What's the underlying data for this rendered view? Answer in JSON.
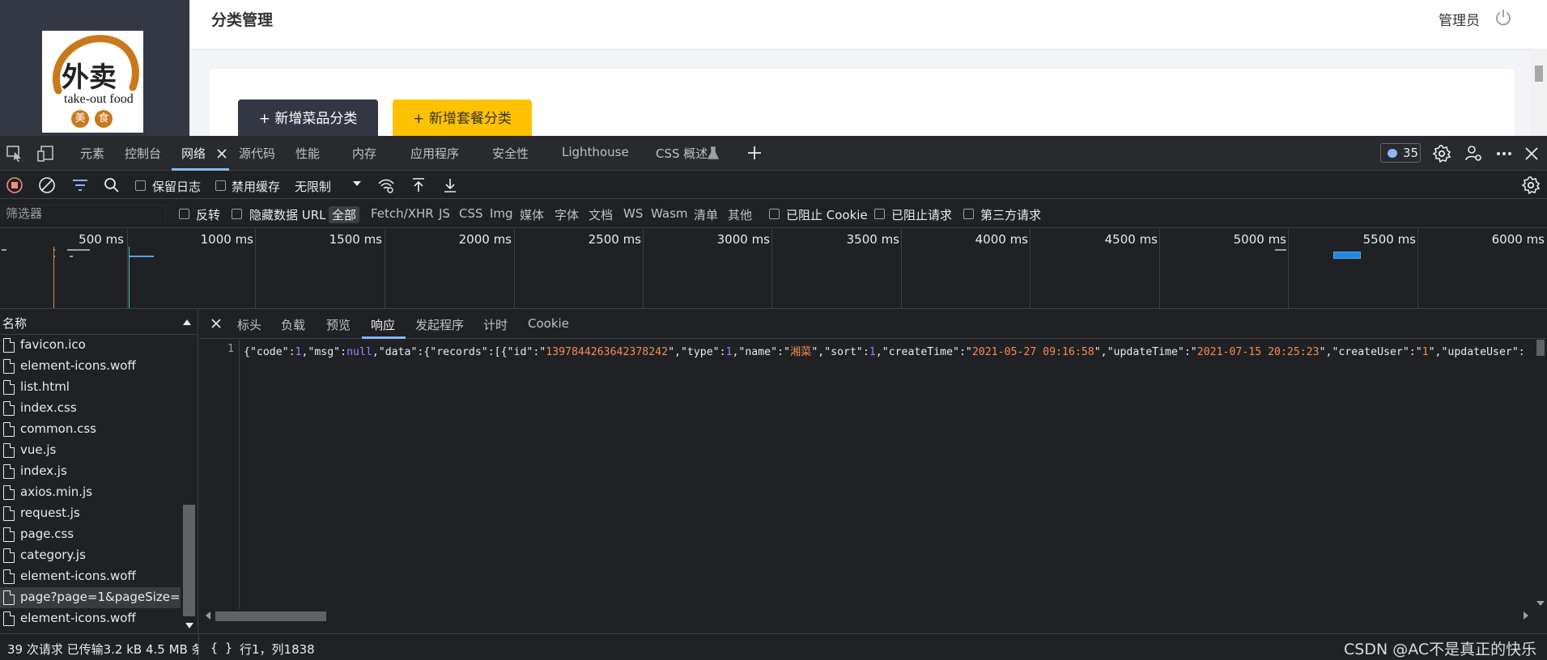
{
  "site": {
    "logo_text": "外卖",
    "logo_sub": "take-out food",
    "logo_seal_1": "美",
    "logo_seal_2": "食",
    "page_title": "分类管理",
    "admin_name": "管理员",
    "add_dish_category": "+ 新增菜品分类",
    "add_set_category": "+ 新增套餐分类"
  },
  "devtools": {
    "tabs": [
      "元素",
      "控制台",
      "网络",
      "源代码",
      "性能",
      "内存",
      "应用程序",
      "安全性",
      "Lighthouse",
      "CSS 概述"
    ],
    "active_tab": "网络",
    "issues_count": "35",
    "toolbar": {
      "preserve_log": "保留日志",
      "disable_cache": "禁用缓存",
      "throttling": "无限制"
    },
    "filter": {
      "placeholder": "筛选器",
      "invert": "反转",
      "hide_data_urls": "隐藏数据 URL",
      "types": [
        "全部",
        "Fetch/XHR",
        "JS",
        "CSS",
        "Img",
        "媒体",
        "字体",
        "文档",
        "WS",
        "Wasm",
        "清单",
        "其他"
      ],
      "selected_type": "全部",
      "blocked_cookies": "已阻止 Cookie",
      "blocked_requests": "已阻止请求",
      "third_party": "第三方请求"
    },
    "timeline_ticks": [
      "500 ms",
      "1000 ms",
      "1500 ms",
      "2000 ms",
      "2500 ms",
      "3000 ms",
      "3500 ms",
      "4000 ms",
      "4500 ms",
      "5000 ms",
      "5500 ms",
      "6000 ms"
    ],
    "names_header": "名称",
    "requests": [
      "favicon.ico",
      "element-icons.woff",
      "list.html",
      "index.css",
      "common.css",
      "vue.js",
      "index.js",
      "axios.min.js",
      "request.js",
      "page.css",
      "category.js",
      "element-icons.woff",
      "page?page=1&pageSize=10",
      "element-icons.woff"
    ],
    "selected_request": "page?page=1&pageSize=10",
    "detail_tabs": [
      "标头",
      "负载",
      "预览",
      "响应",
      "发起程序",
      "计时",
      "Cookie"
    ],
    "active_detail_tab": "响应",
    "line_number": "1",
    "response": {
      "code": "1",
      "msg": "null",
      "id": "1397844263642378242",
      "type": "1",
      "name": "湘菜",
      "sort": "1",
      "createTime": "2021-05-27 09:16:58",
      "updateTime": "2021-07-15 20:25:23",
      "createUser": "1"
    },
    "status": {
      "summary": "39 次请求  已传输3.2 kB  4.5 MB 条",
      "braces": "{ }",
      "cursor": "行1，列1838",
      "watermark": "CSDN @AC不是真正的快乐"
    }
  },
  "colors": {
    "sidebar": "#343744",
    "dish_button": "#333743",
    "set_button": "#ffc200",
    "devtools_bg": "#202124",
    "accent": "#8ab4f8",
    "json_string": "#f28b54",
    "json_number": "#9980ff"
  }
}
